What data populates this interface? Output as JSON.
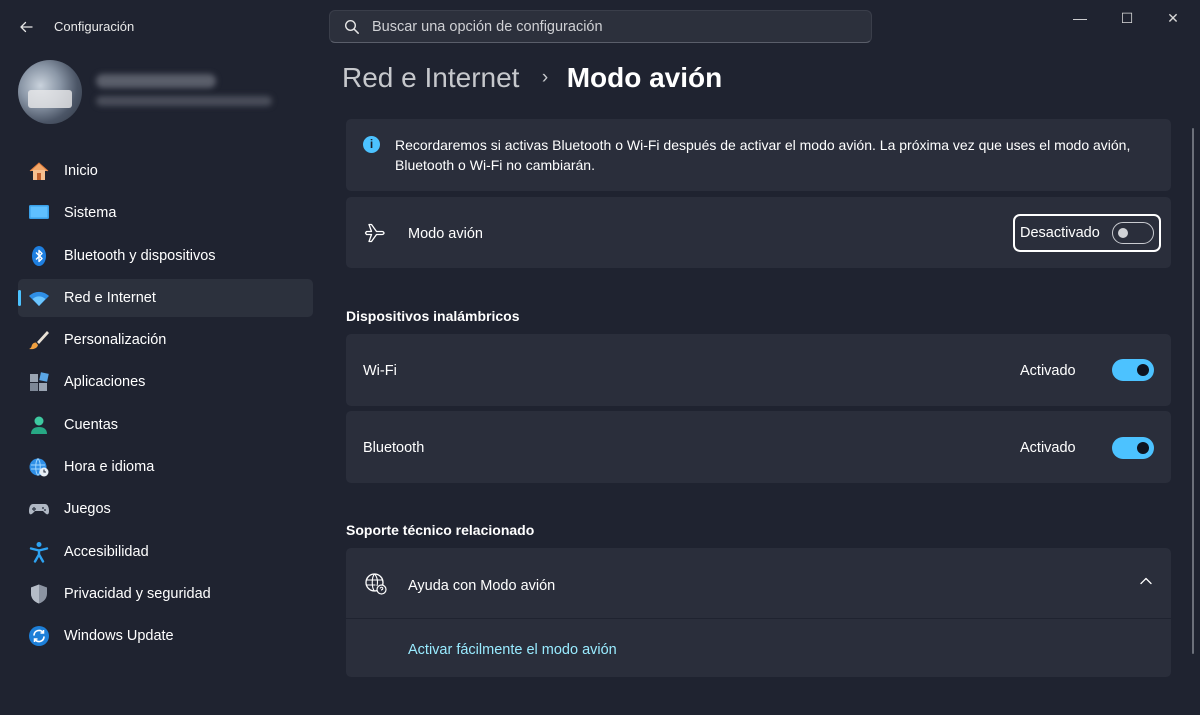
{
  "window": {
    "app_title": "Configuración",
    "controls": {
      "minimize": "—",
      "maximize": "☐",
      "close": "✕"
    }
  },
  "search": {
    "placeholder": "Buscar una opción de configuración"
  },
  "sidebar": {
    "items": [
      {
        "label": "Inicio",
        "icon": "home-icon"
      },
      {
        "label": "Sistema",
        "icon": "monitor-icon"
      },
      {
        "label": "Bluetooth y dispositivos",
        "icon": "bluetooth-icon"
      },
      {
        "label": "Red e Internet",
        "icon": "wifi-icon",
        "active": true
      },
      {
        "label": "Personalización",
        "icon": "brush-icon"
      },
      {
        "label": "Aplicaciones",
        "icon": "apps-icon"
      },
      {
        "label": "Cuentas",
        "icon": "account-icon"
      },
      {
        "label": "Hora e idioma",
        "icon": "time-language-icon"
      },
      {
        "label": "Juegos",
        "icon": "gamepad-icon"
      },
      {
        "label": "Accesibilidad",
        "icon": "accessibility-icon"
      },
      {
        "label": "Privacidad y seguridad",
        "icon": "shield-icon"
      },
      {
        "label": "Windows Update",
        "icon": "update-icon"
      }
    ]
  },
  "breadcrumb": {
    "parent": "Red e Internet",
    "separator": "›",
    "current": "Modo avión"
  },
  "info": {
    "text": "Recordaremos si activas Bluetooth o Wi-Fi después de activar el modo avión. La próxima vez que uses el modo avión, Bluetooth o Wi-Fi no cambiarán."
  },
  "airplane_mode": {
    "label": "Modo avión",
    "state_text": "Desactivado",
    "on": false
  },
  "wireless": {
    "title": "Dispositivos inalámbricos",
    "wifi": {
      "label": "Wi-Fi",
      "state_text": "Activado",
      "on": true
    },
    "bluetooth": {
      "label": "Bluetooth",
      "state_text": "Activado",
      "on": true
    }
  },
  "support": {
    "title": "Soporte técnico relacionado",
    "help_title": "Ayuda con Modo avión",
    "link": "Activar fácilmente el modo avión"
  },
  "colors": {
    "accent": "#4cc2ff",
    "background": "#1f2330",
    "card": "#2a2e3b",
    "link": "#99ebff"
  }
}
